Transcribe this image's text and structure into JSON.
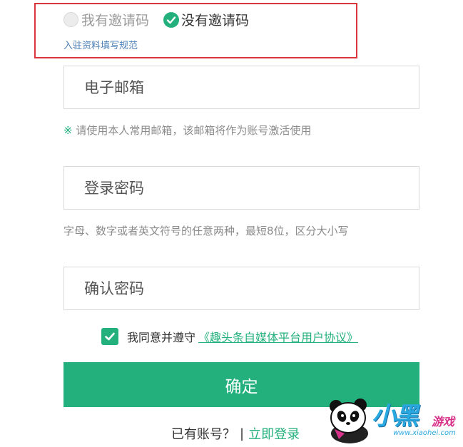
{
  "invite": {
    "option_has_code": "我有邀请码",
    "option_no_code": "没有邀请码",
    "selected": "没有邀请码",
    "rules_link": "入驻资料填写规范"
  },
  "email": {
    "placeholder": "电子邮箱",
    "value": "",
    "hint_mark": "※",
    "hint": "请使用本人常用邮箱，该邮箱将作为账号激活使用"
  },
  "password": {
    "placeholder": "登录密码",
    "value": "",
    "hint": "字母、数字或者英文符号的任意两种，最短8位，区分大小写"
  },
  "confirm_password": {
    "placeholder": "确认密码",
    "value": ""
  },
  "agreement": {
    "checked": true,
    "text": "我同意并遵守",
    "link": "《趣头条自媒体平台用户协议》"
  },
  "submit": {
    "label": "确定"
  },
  "login": {
    "prompt": "已有账号？",
    "separator": "|",
    "link": "立即登录"
  },
  "watermark": {
    "brand": "小黑",
    "suffix": "游戏",
    "url": "www.xiaohei.com"
  },
  "colors": {
    "accent": "#23b07d",
    "highlight_border": "#d9363e",
    "link_blue": "#4c7fb6"
  }
}
